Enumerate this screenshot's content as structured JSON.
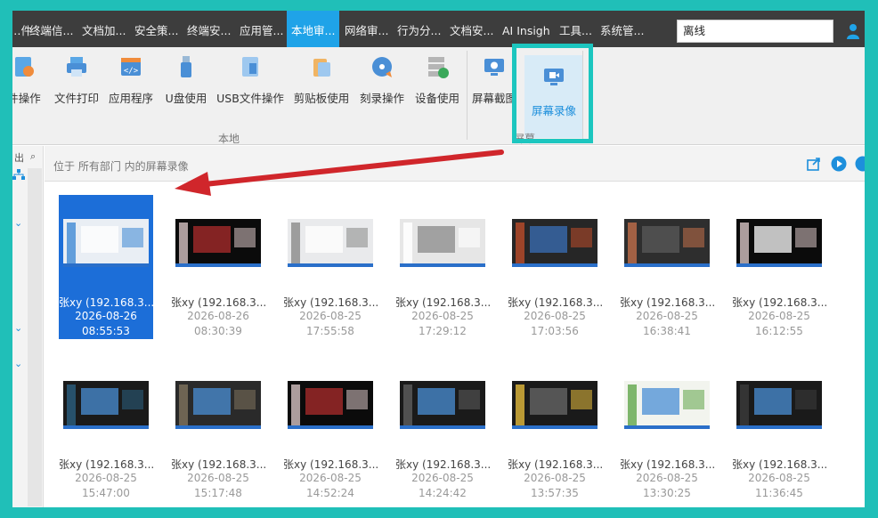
{
  "nav": {
    "tabs": [
      "…件…",
      "终端信...",
      "文档加...",
      "安全策...",
      "终端安...",
      "应用管...",
      "本地审...",
      "网络审...",
      "行为分...",
      "文档安...",
      "AI Insigh",
      "工具...",
      "系统管..."
    ],
    "search_value": "离线"
  },
  "ribbon": {
    "tools": [
      "件操作",
      "文件打印",
      "应用程序",
      "U盘使用",
      "USB文件操作",
      "剪贴板使用",
      "刻录操作",
      "设备使用",
      "屏幕截图",
      "屏幕录像"
    ],
    "group_local": "本地",
    "group_screen": "屏幕"
  },
  "left": {
    "search_label": "出",
    "search_icon": "search-icon"
  },
  "pathbar": {
    "text": "位于 所有部门 内的屏幕录像"
  },
  "recordings": [
    {
      "name": "张xy (192.168.3...",
      "date": "2026-08-26",
      "time": "08:55:53"
    },
    {
      "name": "张xy (192.168.3...",
      "date": "2026-08-26",
      "time": "08:30:39"
    },
    {
      "name": "张xy (192.168.3...",
      "date": "2026-08-25",
      "time": "17:55:58"
    },
    {
      "name": "张xy (192.168.3...",
      "date": "2026-08-25",
      "time": "17:29:12"
    },
    {
      "name": "张xy (192.168.3...",
      "date": "2026-08-25",
      "time": "17:03:56"
    },
    {
      "name": "张xy (192.168.3...",
      "date": "2026-08-25",
      "time": "16:38:41"
    },
    {
      "name": "张xy (192.168.3...",
      "date": "2026-08-25",
      "time": "16:12:55"
    },
    {
      "name": "张xy (192.168.3...",
      "date": "2026-08-25",
      "time": "15:47:00"
    },
    {
      "name": "张xy (192.168.3...",
      "date": "2026-08-25",
      "time": "15:17:48"
    },
    {
      "name": "张xy (192.168.3...",
      "date": "2026-08-25",
      "time": "14:52:24"
    },
    {
      "name": "张xy (192.168.3...",
      "date": "2026-08-25",
      "time": "14:24:42"
    },
    {
      "name": "张xy (192.168.3...",
      "date": "2026-08-25",
      "time": "13:57:35"
    },
    {
      "name": "张xy (192.168.3...",
      "date": "2026-08-25",
      "time": "13:30:25"
    },
    {
      "name": "张xy (192.168.3...",
      "date": "2026-08-25",
      "time": "11:36:45"
    }
  ],
  "colors": {
    "accent": "#1fa3e8",
    "selected": "#1c6ed8",
    "highlight": "#1cc6bf",
    "arrow": "#d0262b"
  }
}
